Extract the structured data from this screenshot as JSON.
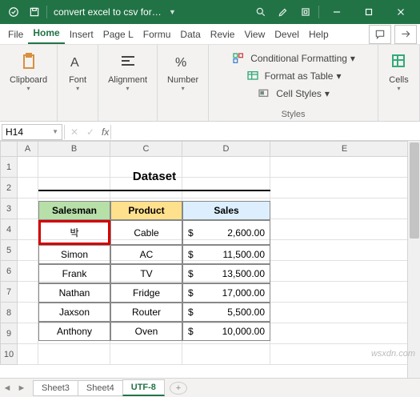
{
  "titlebar": {
    "filename": "convert excel to csv format"
  },
  "menu": {
    "file": "File",
    "home": "Home",
    "insert": "Insert",
    "page": "Page L",
    "formulas": "Formu",
    "data": "Data",
    "review": "Revie",
    "view": "View",
    "developer": "Devel",
    "help": "Help"
  },
  "ribbon": {
    "clipboard": "Clipboard",
    "font": "Font",
    "alignment": "Alignment",
    "number": "Number",
    "styles": "Styles",
    "cells": "Cells",
    "cond_fmt": "Conditional Formatting",
    "fmt_table": "Format as Table",
    "cell_styles": "Cell Styles"
  },
  "namebox": "H14",
  "fx": "fx",
  "cols": {
    "A": "A",
    "B": "B",
    "C": "C",
    "D": "D",
    "E": "E"
  },
  "rownums": [
    "1",
    "2",
    "3",
    "4",
    "5",
    "6",
    "7",
    "8",
    "9",
    "10"
  ],
  "dataset": {
    "title": "Dataset",
    "headers": {
      "salesman": "Salesman",
      "product": "Product",
      "sales": "Sales"
    },
    "currency": "$",
    "rows": [
      {
        "salesman": "박",
        "product": "Cable",
        "sales": "2,600.00"
      },
      {
        "salesman": "Simon",
        "product": "AC",
        "sales": "11,500.00"
      },
      {
        "salesman": "Frank",
        "product": "TV",
        "sales": "13,500.00"
      },
      {
        "salesman": "Nathan",
        "product": "Fridge",
        "sales": "17,000.00"
      },
      {
        "salesman": "Jaxson",
        "product": "Router",
        "sales": "5,500.00"
      },
      {
        "salesman": "Anthony",
        "product": "Oven",
        "sales": "10,000.00"
      }
    ]
  },
  "tabs": {
    "sheet3": "Sheet3",
    "sheet4": "Sheet4",
    "utf8": "UTF-8"
  },
  "watermark": "wsxdn.com"
}
